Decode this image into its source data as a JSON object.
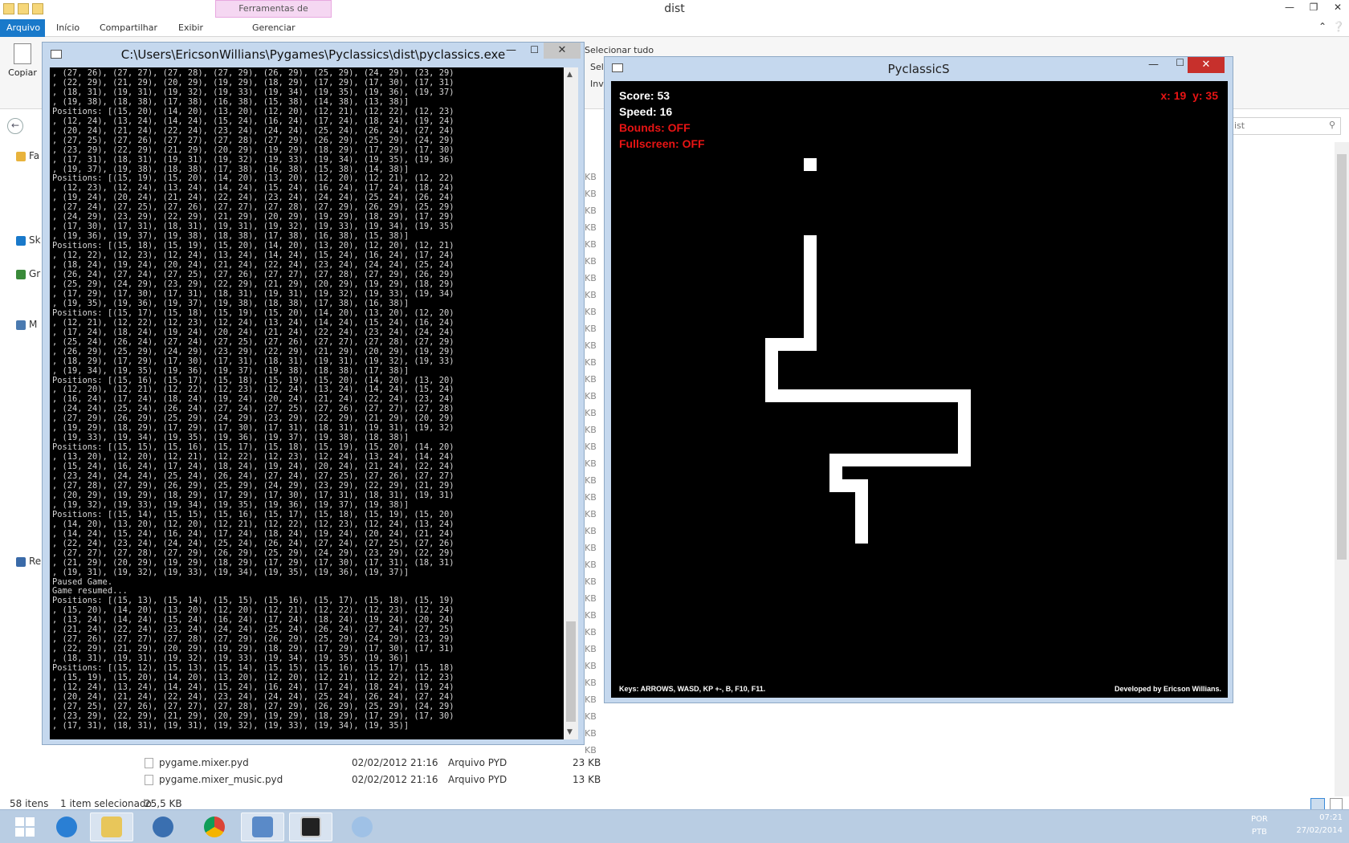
{
  "explorer": {
    "window_title": "dist",
    "context_tab": "Ferramentas de Aplicativo",
    "tabs": [
      "Arquivo",
      "Início",
      "Compartilhar",
      "Exibir",
      "Gerenciar"
    ],
    "copy_label": "Copiar",
    "select_all": "Selecionar tudo",
    "select_partial": "Sel",
    "invert_partial": "Inv",
    "search_placeholder": "ist",
    "sidebar": [
      "Fa",
      "Sk",
      "Gr",
      "M",
      "Re"
    ],
    "size_unit": "KB",
    "files": [
      {
        "name": "pygame.mixer.pyd",
        "date": "02/02/2012 21:16",
        "type": "Arquivo PYD",
        "size": "23 KB"
      },
      {
        "name": "pygame.mixer_music.pyd",
        "date": "02/02/2012 21:16",
        "type": "Arquivo PYD",
        "size": "13 KB"
      }
    ],
    "status": {
      "items": "58 itens",
      "selected": "1 item selecionado",
      "size": "25,5 KB"
    }
  },
  "console": {
    "title": "C:\\Users\\EricsonWillians\\Pygames\\Pyclassics\\dist\\pyclassics.exe",
    "text": ", (27, 26), (27, 27), (27, 28), (27, 29), (26, 29), (25, 29), (24, 29), (23, 29)\n, (22, 29), (21, 29), (20, 29), (19, 29), (18, 29), (17, 29), (17, 30), (17, 31)\n, (18, 31), (19, 31), (19, 32), (19, 33), (19, 34), (19, 35), (19, 36), (19, 37)\n, (19, 38), (18, 38), (17, 38), (16, 38), (15, 38), (14, 38), (13, 38)]\nPositions: [(15, 20), (14, 20), (13, 20), (12, 20), (12, 21), (12, 22), (12, 23)\n, (12, 24), (13, 24), (14, 24), (15, 24), (16, 24), (17, 24), (18, 24), (19, 24)\n, (20, 24), (21, 24), (22, 24), (23, 24), (24, 24), (25, 24), (26, 24), (27, 24)\n, (27, 25), (27, 26), (27, 27), (27, 28), (27, 29), (26, 29), (25, 29), (24, 29)\n, (23, 29), (22, 29), (21, 29), (20, 29), (19, 29), (18, 29), (17, 29), (17, 30)\n, (17, 31), (18, 31), (19, 31), (19, 32), (19, 33), (19, 34), (19, 35), (19, 36)\n, (19, 37), (19, 38), (18, 38), (17, 38), (16, 38), (15, 38), (14, 38)]\nPositions: [(15, 19), (15, 20), (14, 20), (13, 20), (12, 20), (12, 21), (12, 22)\n, (12, 23), (12, 24), (13, 24), (14, 24), (15, 24), (16, 24), (17, 24), (18, 24)\n, (19, 24), (20, 24), (21, 24), (22, 24), (23, 24), (24, 24), (25, 24), (26, 24)\n, (27, 24), (27, 25), (27, 26), (27, 27), (27, 28), (27, 29), (26, 29), (25, 29)\n, (24, 29), (23, 29), (22, 29), (21, 29), (20, 29), (19, 29), (18, 29), (17, 29)\n, (17, 30), (17, 31), (18, 31), (19, 31), (19, 32), (19, 33), (19, 34), (19, 35)\n, (19, 36), (19, 37), (19, 38), (18, 38), (17, 38), (16, 38), (15, 38)]\nPositions: [(15, 18), (15, 19), (15, 20), (14, 20), (13, 20), (12, 20), (12, 21)\n, (12, 22), (12, 23), (12, 24), (13, 24), (14, 24), (15, 24), (16, 24), (17, 24)\n, (18, 24), (19, 24), (20, 24), (21, 24), (22, 24), (23, 24), (24, 24), (25, 24)\n, (26, 24), (27, 24), (27, 25), (27, 26), (27, 27), (27, 28), (27, 29), (26, 29)\n, (25, 29), (24, 29), (23, 29), (22, 29), (21, 29), (20, 29), (19, 29), (18, 29)\n, (17, 29), (17, 30), (17, 31), (18, 31), (19, 31), (19, 32), (19, 33), (19, 34)\n, (19, 35), (19, 36), (19, 37), (19, 38), (18, 38), (17, 38), (16, 38)]\nPositions: [(15, 17), (15, 18), (15, 19), (15, 20), (14, 20), (13, 20), (12, 20)\n, (12, 21), (12, 22), (12, 23), (12, 24), (13, 24), (14, 24), (15, 24), (16, 24)\n, (17, 24), (18, 24), (19, 24), (20, 24), (21, 24), (22, 24), (23, 24), (24, 24)\n, (25, 24), (26, 24), (27, 24), (27, 25), (27, 26), (27, 27), (27, 28), (27, 29)\n, (26, 29), (25, 29), (24, 29), (23, 29), (22, 29), (21, 29), (20, 29), (19, 29)\n, (18, 29), (17, 29), (17, 30), (17, 31), (18, 31), (19, 31), (19, 32), (19, 33)\n, (19, 34), (19, 35), (19, 36), (19, 37), (19, 38), (18, 38), (17, 38)]\nPositions: [(15, 16), (15, 17), (15, 18), (15, 19), (15, 20), (14, 20), (13, 20)\n, (12, 20), (12, 21), (12, 22), (12, 23), (12, 24), (13, 24), (14, 24), (15, 24)\n, (16, 24), (17, 24), (18, 24), (19, 24), (20, 24), (21, 24), (22, 24), (23, 24)\n, (24, 24), (25, 24), (26, 24), (27, 24), (27, 25), (27, 26), (27, 27), (27, 28)\n, (27, 29), (26, 29), (25, 29), (24, 29), (23, 29), (22, 29), (21, 29), (20, 29)\n, (19, 29), (18, 29), (17, 29), (17, 30), (17, 31), (18, 31), (19, 31), (19, 32)\n, (19, 33), (19, 34), (19, 35), (19, 36), (19, 37), (19, 38), (18, 38)]\nPositions: [(15, 15), (15, 16), (15, 17), (15, 18), (15, 19), (15, 20), (14, 20)\n, (13, 20), (12, 20), (12, 21), (12, 22), (12, 23), (12, 24), (13, 24), (14, 24)\n, (15, 24), (16, 24), (17, 24), (18, 24), (19, 24), (20, 24), (21, 24), (22, 24)\n, (23, 24), (24, 24), (25, 24), (26, 24), (27, 24), (27, 25), (27, 26), (27, 27)\n, (27, 28), (27, 29), (26, 29), (25, 29), (24, 29), (23, 29), (22, 29), (21, 29)\n, (20, 29), (19, 29), (18, 29), (17, 29), (17, 30), (17, 31), (18, 31), (19, 31)\n, (19, 32), (19, 33), (19, 34), (19, 35), (19, 36), (19, 37), (19, 38)]\nPositions: [(15, 14), (15, 15), (15, 16), (15, 17), (15, 18), (15, 19), (15, 20)\n, (14, 20), (13, 20), (12, 20), (12, 21), (12, 22), (12, 23), (12, 24), (13, 24)\n, (14, 24), (15, 24), (16, 24), (17, 24), (18, 24), (19, 24), (20, 24), (21, 24)\n, (22, 24), (23, 24), (24, 24), (25, 24), (26, 24), (27, 24), (27, 25), (27, 26)\n, (27, 27), (27, 28), (27, 29), (26, 29), (25, 29), (24, 29), (23, 29), (22, 29)\n, (21, 29), (20, 29), (19, 29), (18, 29), (17, 29), (17, 30), (17, 31), (18, 31)\n, (19, 31), (19, 32), (19, 33), (19, 34), (19, 35), (19, 36), (19, 37)]\nPaused Game.\nGame resumed...\nPositions: [(15, 13), (15, 14), (15, 15), (15, 16), (15, 17), (15, 18), (15, 19)\n, (15, 20), (14, 20), (13, 20), (12, 20), (12, 21), (12, 22), (12, 23), (12, 24)\n, (13, 24), (14, 24), (15, 24), (16, 24), (17, 24), (18, 24), (19, 24), (20, 24)\n, (21, 24), (22, 24), (23, 24), (24, 24), (25, 24), (26, 24), (27, 24), (27, 25)\n, (27, 26), (27, 27), (27, 28), (27, 29), (26, 29), (25, 29), (24, 29), (23, 29)\n, (22, 29), (21, 29), (20, 29), (19, 29), (18, 29), (17, 29), (17, 30), (17, 31)\n, (18, 31), (19, 31), (19, 32), (19, 33), (19, 34), (19, 35), (19, 36)]\nPositions: [(15, 12), (15, 13), (15, 14), (15, 15), (15, 16), (15, 17), (15, 18)\n, (15, 19), (15, 20), (14, 20), (13, 20), (12, 20), (12, 21), (12, 22), (12, 23)\n, (12, 24), (13, 24), (14, 24), (15, 24), (16, 24), (17, 24), (18, 24), (19, 24)\n, (20, 24), (21, 24), (22, 24), (23, 24), (24, 24), (25, 24), (26, 24), (27, 24)\n, (27, 25), (27, 26), (27, 27), (27, 28), (27, 29), (26, 29), (25, 29), (24, 29)\n, (23, 29), (22, 29), (21, 29), (20, 29), (19, 29), (18, 29), (17, 29), (17, 30)\n, (17, 31), (18, 31), (19, 31), (19, 32), (19, 33), (19, 34), (19, 35)]"
  },
  "game": {
    "title": "PyclassicS",
    "score": "Score: 53",
    "speed": "Speed: 16",
    "bounds": "Bounds: OFF",
    "fullscreen": "Fullscreen: OFF",
    "coords": "x: 19  y: 35",
    "keys": "Keys: ARROWS, WASD, KP +-, B, F10, F11.",
    "credit": "Developed by Ericson Willians.",
    "grid_cells": 48,
    "food": [
      15,
      6
    ],
    "snake": [
      [
        15,
        12
      ],
      [
        15,
        13
      ],
      [
        15,
        14
      ],
      [
        15,
        15
      ],
      [
        15,
        16
      ],
      [
        15,
        17
      ],
      [
        15,
        18
      ],
      [
        15,
        19
      ],
      [
        15,
        20
      ],
      [
        14,
        20
      ],
      [
        13,
        20
      ],
      [
        12,
        20
      ],
      [
        12,
        21
      ],
      [
        12,
        22
      ],
      [
        12,
        23
      ],
      [
        12,
        24
      ],
      [
        13,
        24
      ],
      [
        14,
        24
      ],
      [
        15,
        24
      ],
      [
        16,
        24
      ],
      [
        17,
        24
      ],
      [
        18,
        24
      ],
      [
        19,
        24
      ],
      [
        20,
        24
      ],
      [
        21,
        24
      ],
      [
        22,
        24
      ],
      [
        23,
        24
      ],
      [
        24,
        24
      ],
      [
        25,
        24
      ],
      [
        26,
        24
      ],
      [
        27,
        24
      ],
      [
        27,
        25
      ],
      [
        27,
        26
      ],
      [
        27,
        27
      ],
      [
        27,
        28
      ],
      [
        27,
        29
      ],
      [
        26,
        29
      ],
      [
        25,
        29
      ],
      [
        24,
        29
      ],
      [
        23,
        29
      ],
      [
        22,
        29
      ],
      [
        21,
        29
      ],
      [
        20,
        29
      ],
      [
        19,
        29
      ],
      [
        18,
        29
      ],
      [
        17,
        29
      ],
      [
        17,
        30
      ],
      [
        17,
        31
      ],
      [
        18,
        31
      ],
      [
        19,
        31
      ],
      [
        19,
        32
      ],
      [
        19,
        33
      ],
      [
        19,
        34
      ],
      [
        19,
        35
      ]
    ]
  },
  "taskbar": {
    "apps": [
      "start-button",
      "ie-icon",
      "explorer-icon",
      "python-icon",
      "chrome-icon",
      "control-panel-icon",
      "console-icon",
      "paint-icon"
    ],
    "lang_top": "POR",
    "lang_bottom": "PTB",
    "time": "07:21",
    "date": "27/02/2014"
  }
}
